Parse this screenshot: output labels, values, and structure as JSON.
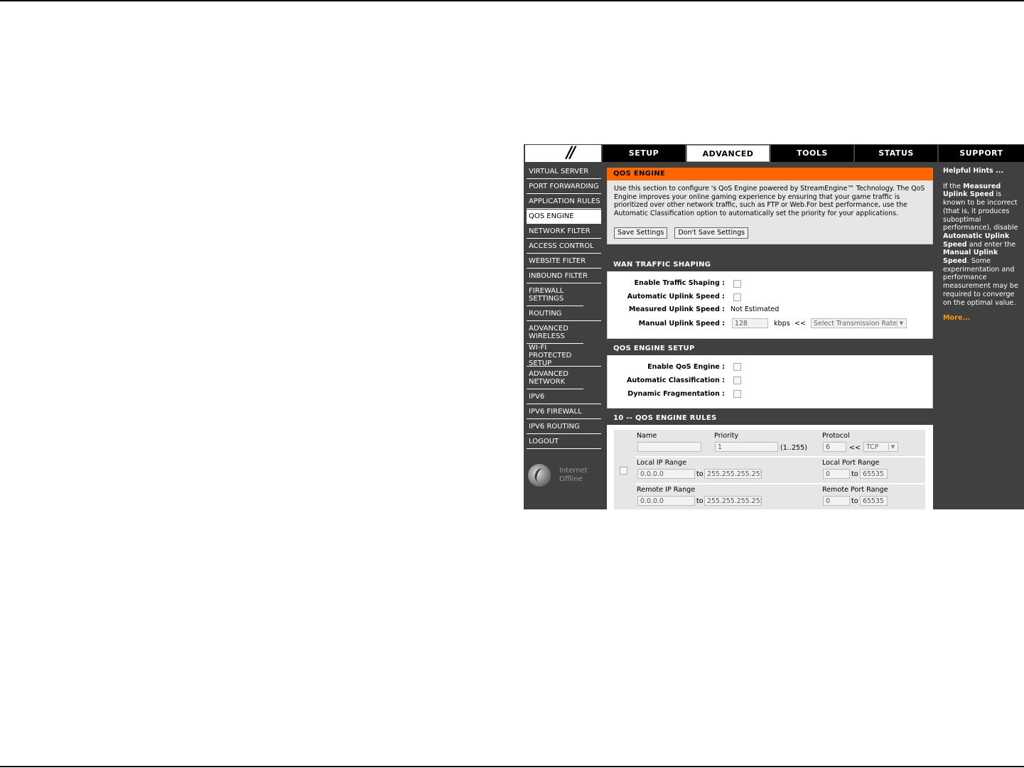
{
  "header": {
    "tabs": [
      {
        "label": "SETUP",
        "active": false
      },
      {
        "label": "ADVANCED",
        "active": true
      },
      {
        "label": "TOOLS",
        "active": false
      },
      {
        "label": "STATUS",
        "active": false
      },
      {
        "label": "SUPPORT",
        "active": false
      }
    ]
  },
  "sidebar": {
    "items": [
      {
        "label": "VIRTUAL SERVER"
      },
      {
        "label": "PORT FORWARDING"
      },
      {
        "label": "APPLICATION RULES"
      },
      {
        "label": "QOS ENGINE",
        "selected": true
      },
      {
        "label": "NETWORK FILTER"
      },
      {
        "label": "ACCESS CONTROL"
      },
      {
        "label": "WEBSITE FILTER"
      },
      {
        "label": "INBOUND FILTER"
      },
      {
        "label": "FIREWALL SETTINGS"
      },
      {
        "label": "ROUTING"
      },
      {
        "label": "ADVANCED WIRELESS"
      },
      {
        "label": "WI-FI PROTECTED SETUP"
      },
      {
        "label": "ADVANCED NETWORK"
      },
      {
        "label": "IPV6"
      },
      {
        "label": "IPV6 FIREWALL"
      },
      {
        "label": "IPV6 ROUTING"
      },
      {
        "label": "LOGOUT"
      }
    ],
    "internet_status": {
      "line1": "Internet",
      "line2": "Offline"
    }
  },
  "qos_engine": {
    "title": "QOS ENGINE",
    "description": "Use this section to configure 's QoS Engine powered by StreamEngine™ Technology. The QoS Engine improves your online gaming experience by ensuring that your game traffic is prioritized over other network traffic, such as FTP or Web.For best performance, use the Automatic Classification option to automatically set the priority for your applications.",
    "save_label": "Save Settings",
    "dont_save_label": "Don't Save Settings"
  },
  "wan": {
    "title": "WAN TRAFFIC SHAPING",
    "enable_label": "Enable Traffic Shaping :",
    "auto_uplink_label": "Automatic Uplink Speed :",
    "measured_label": "Measured Uplink Speed :",
    "measured_value": "Not Estimated",
    "manual_label": "Manual Uplink Speed :",
    "manual_value": "128",
    "unit": "kbps",
    "arrows": "<<",
    "rate_select": "Select Transmission Rate"
  },
  "setup": {
    "title": "QOS ENGINE SETUP",
    "enable_label": "Enable QoS Engine :",
    "auto_class_label": "Automatic Classification :",
    "dyn_frag_label": "Dynamic Fragmentation :"
  },
  "rules": {
    "title": "10 -- QOS ENGINE RULES",
    "name_label": "Name",
    "name_value": "",
    "priority_label": "Priority",
    "priority_value": "1",
    "priority_range": "(1..255)",
    "protocol_label": "Protocol",
    "protocol_value": "6",
    "protocol_arrows": "<<",
    "protocol_select": "TCP",
    "local_ip_label": "Local IP Range",
    "local_ip_from": "0.0.0.0",
    "local_ip_to": "255.255.255.255",
    "local_port_label": "Local Port Range",
    "local_port_from": "0",
    "local_port_to": "65535",
    "remote_ip_label": "Remote IP Range",
    "remote_ip_from": "0.0.0.0",
    "remote_ip_to": "255.255.255.255",
    "remote_port_label": "Remote Port Range",
    "remote_port_from": "0",
    "remote_port_to": "65535",
    "to_label": "to"
  },
  "hints": {
    "title": "Helpful Hints ...",
    "p1": "If the ",
    "b1": "Measured Uplink Speed",
    "p2": " is known to be incorrect (that is, it produces suboptimal performance), disable ",
    "b2": "Automatic Uplink Speed",
    "p3": " and enter the ",
    "b3": "Manual Uplink Speed",
    "p4": ". Some experimentation and performance measurement may be required to converge on the optimal value.",
    "more": "More..."
  }
}
